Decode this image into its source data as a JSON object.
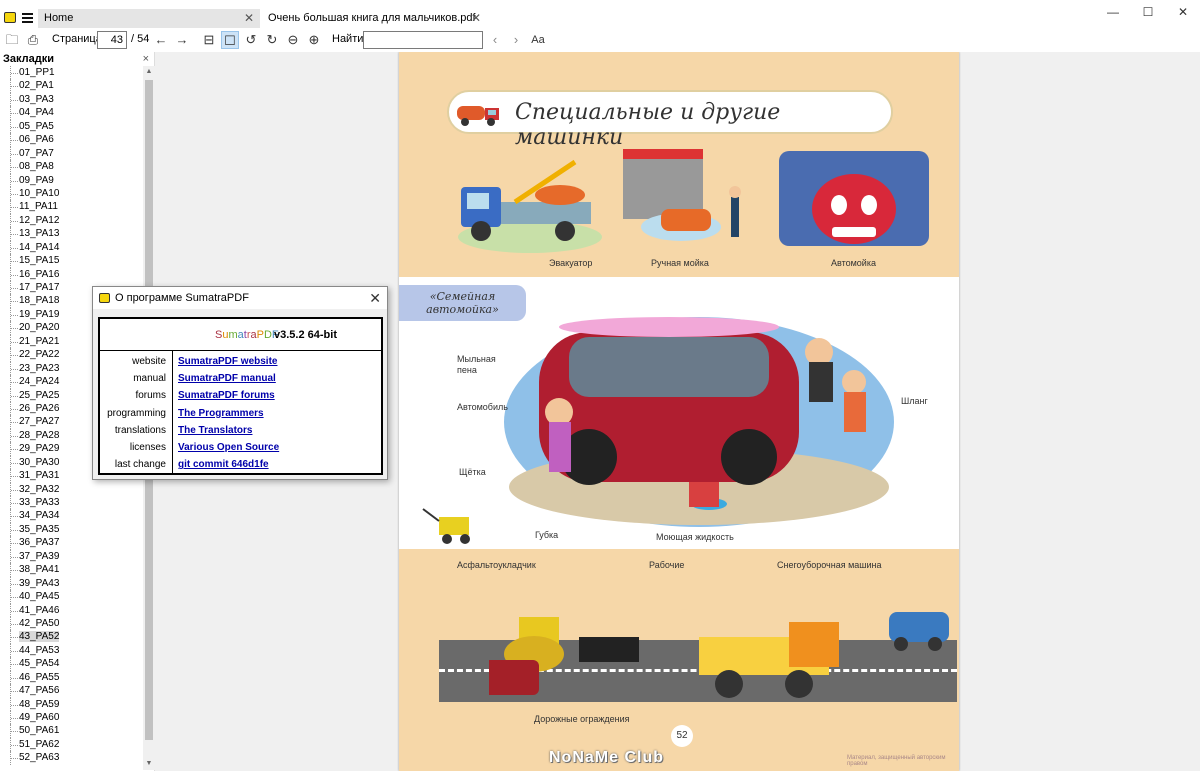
{
  "titlebar": {
    "tabs": [
      {
        "label": "Home"
      },
      {
        "label": "Очень большая книга для мальчиков.pdf"
      }
    ],
    "close_glyph": "✕",
    "minimize_glyph": "—",
    "maximize_glyph": "☐"
  },
  "toolbar": {
    "page_label": "Страница:",
    "page_value": "43",
    "page_total": "/ 54",
    "find_label": "Найти:",
    "find_value": ""
  },
  "sidebar": {
    "title": "Закладки",
    "close_glyph": "×",
    "selected_index": 42,
    "items": [
      "01_PP1",
      "02_PA1",
      "03_PA3",
      "04_PA4",
      "05_PA5",
      "06_PA6",
      "07_PA7",
      "08_PA8",
      "09_PA9",
      "10_PA10",
      "11_PA11",
      "12_PA12",
      "13_PA13",
      "14_PA14",
      "15_PA15",
      "16_PA16",
      "17_PA17",
      "18_PA18",
      "19_PA19",
      "20_PA20",
      "21_PA21",
      "22_PA22",
      "23_PA23",
      "24_PA24",
      "25_PA25",
      "26_PA26",
      "27_PA27",
      "28_PA28",
      "29_PA29",
      "30_PA30",
      "31_PA31",
      "32_PA32",
      "33_PA33",
      "34_PA34",
      "35_PA35",
      "36_PA37",
      "37_PA39",
      "38_PA41",
      "39_PA43",
      "40_PA45",
      "41_PA46",
      "42_PA50",
      "43_PA52",
      "44_PA53",
      "45_PA54",
      "46_PA55",
      "47_PA56",
      "48_PA59",
      "49_PA60",
      "50_PA61",
      "51_PA62",
      "52_PA63"
    ]
  },
  "document": {
    "page_title": "Специальные и другие машинки",
    "labels": {
      "evacuator": "Эвакуатор",
      "hand_wash": "Ручная мойка",
      "car_wash": "Автомойка",
      "family_wash": "«Семейная автомойка»",
      "foam": "Мыльная пена",
      "car": "Автомобиль",
      "hose": "Шланг",
      "brush": "Щётка",
      "sponge": "Губка",
      "detergent": "Моющая жидкость",
      "paver": "Асфальтоукладчик",
      "workers": "Рабочие",
      "snowplow": "Снегоуборочная машина",
      "barriers": "Дорожные ограждения"
    },
    "page_number": "52",
    "watermark": "NoNaMe Club",
    "copyright": "Материал, защищенный авторским правом"
  },
  "about_dialog": {
    "title": "О программе SumatraPDF",
    "close_glyph": "✕",
    "brand": "SumatraPDF",
    "version": "v3.5.2 64-bit",
    "rows": [
      {
        "key": "website",
        "value": "SumatraPDF website"
      },
      {
        "key": "manual",
        "value": "SumatraPDF manual"
      },
      {
        "key": "forums",
        "value": "SumatraPDF forums"
      },
      {
        "key": "programming",
        "value": "The Programmers"
      },
      {
        "key": "translations",
        "value": "The Translators"
      },
      {
        "key": "licenses",
        "value": "Various Open Source"
      },
      {
        "key": "last change",
        "value": "git commit 646d1fe"
      }
    ]
  }
}
